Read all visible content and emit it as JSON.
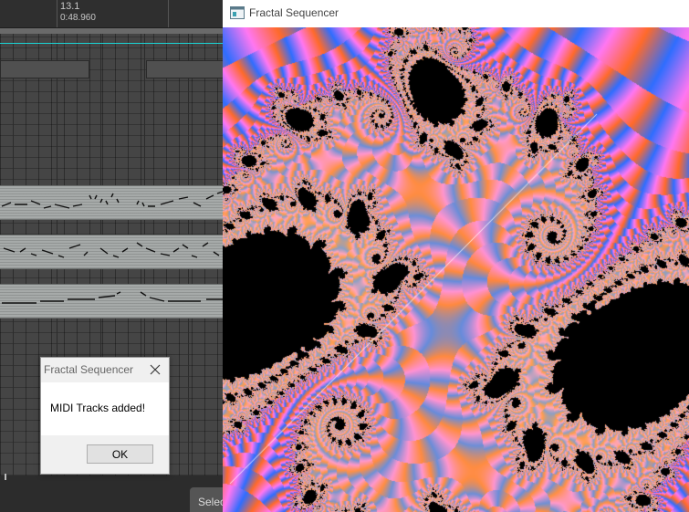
{
  "daw": {
    "bar_number": "13.1",
    "time_readout": "0:48.960",
    "status_tab_text": "Selec",
    "accent_color": "#1ad3d3"
  },
  "fractal_window": {
    "title": "Fractal Sequencer",
    "fractal_colors": [
      "#ff77f2",
      "#2f6dff",
      "#ff6a2a",
      "#000000"
    ]
  },
  "dialog": {
    "title": "Fractal Sequencer",
    "message": "MIDI Tracks added!",
    "ok_label": "OK",
    "close_icon": "close-icon"
  }
}
